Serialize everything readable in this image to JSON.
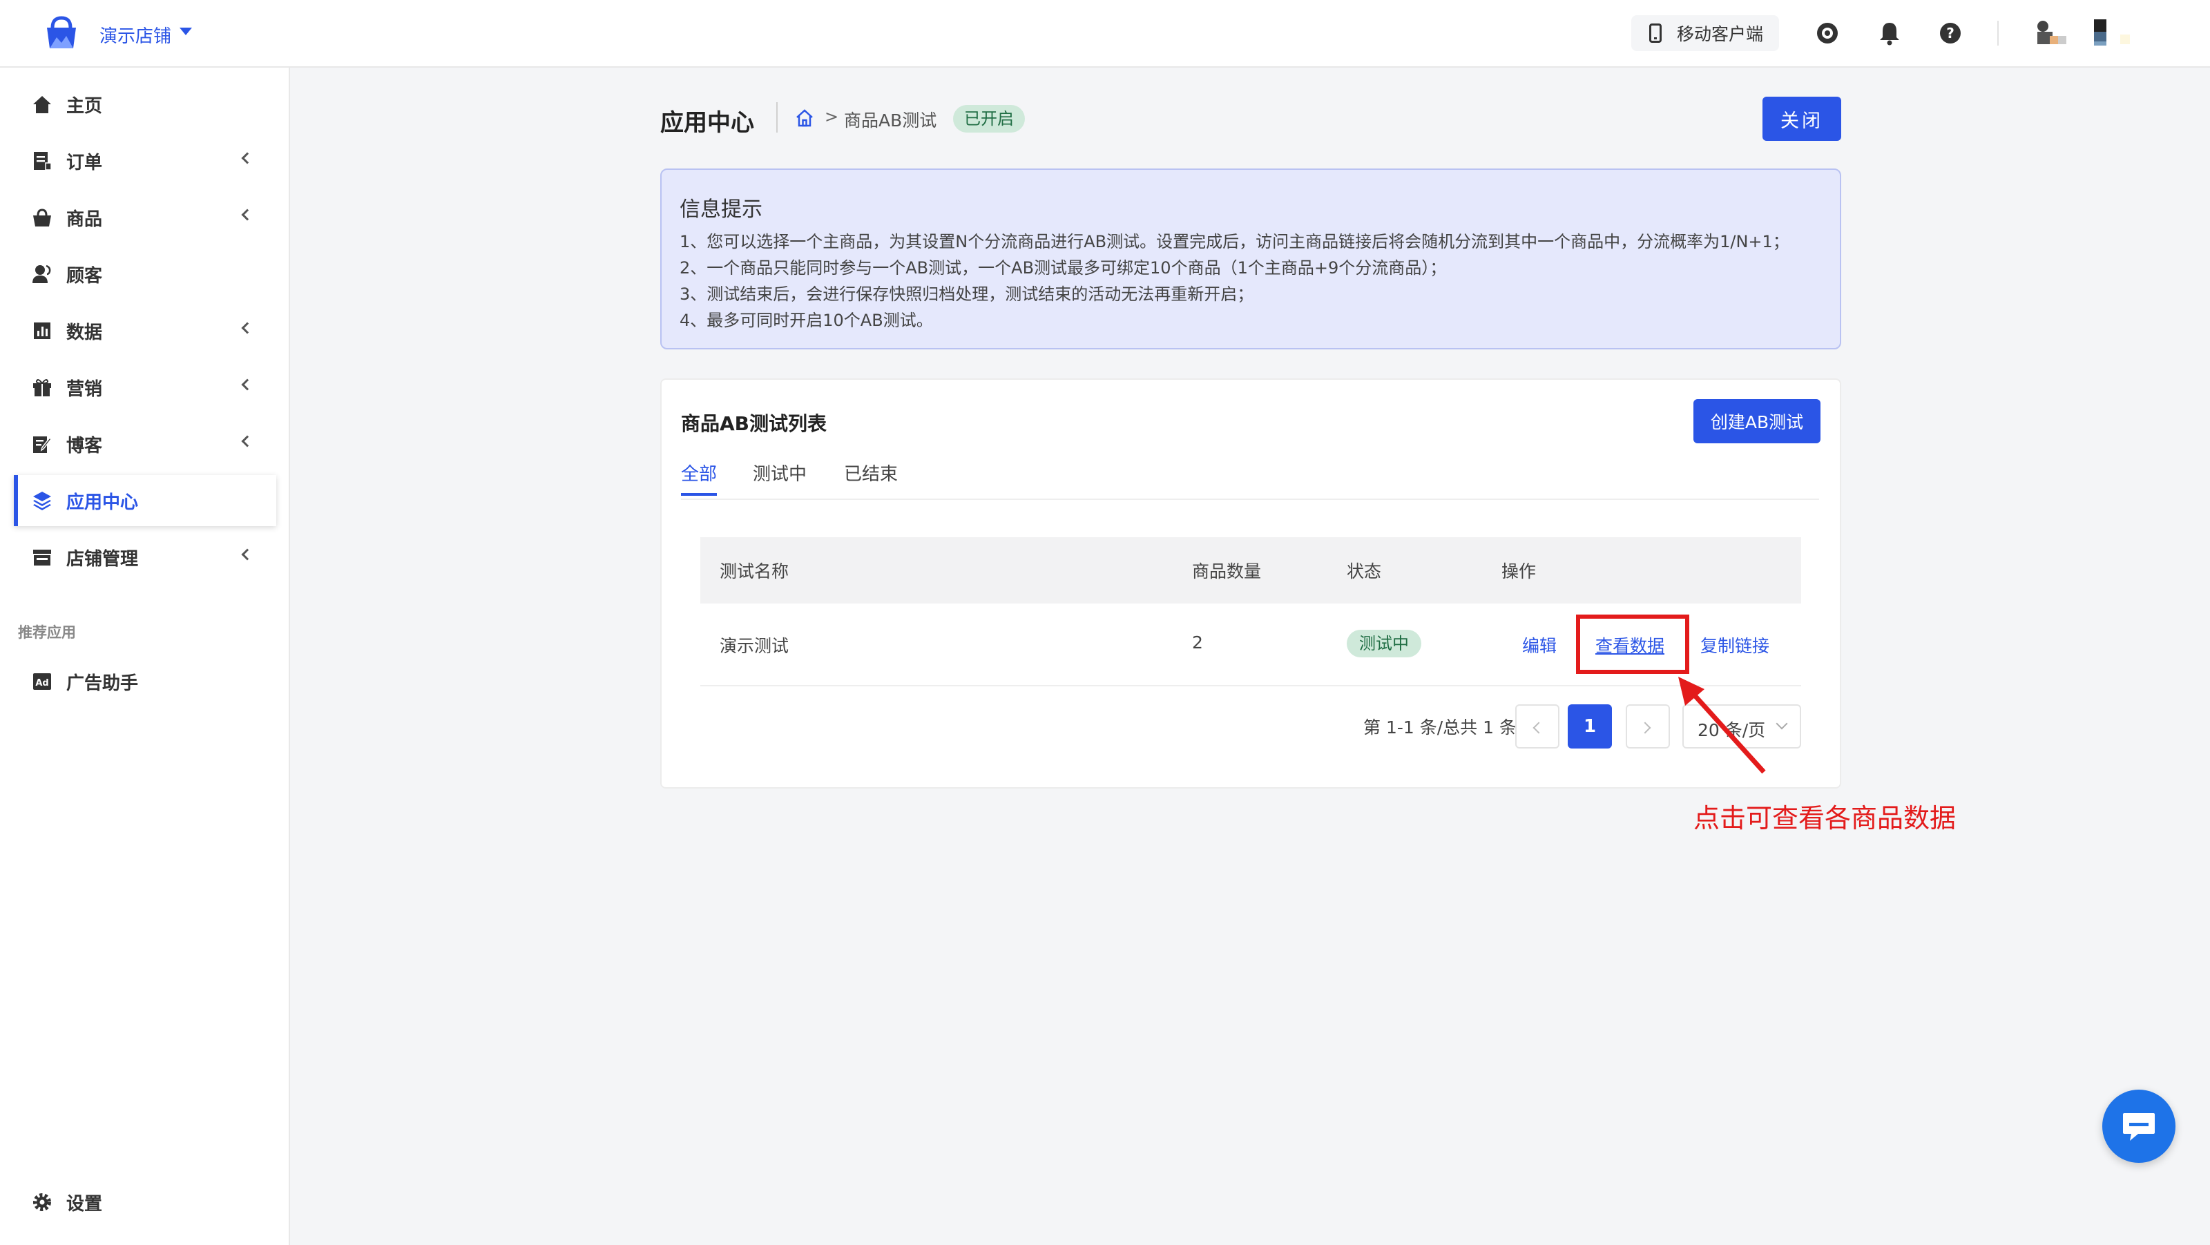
{
  "header": {
    "store_name": "演示店铺",
    "mobile_client_label": "移动客户端",
    "icons": [
      "eye-icon",
      "bell-icon",
      "help-icon"
    ]
  },
  "sidebar": {
    "items": [
      {
        "label": "主页",
        "icon": "home-icon",
        "has_submenu": false
      },
      {
        "label": "订单",
        "icon": "order-icon",
        "has_submenu": true
      },
      {
        "label": "商品",
        "icon": "basket-icon",
        "has_submenu": true
      },
      {
        "label": "顾客",
        "icon": "users-icon",
        "has_submenu": false
      },
      {
        "label": "数据",
        "icon": "chart-icon",
        "has_submenu": true
      },
      {
        "label": "营销",
        "icon": "gift-icon",
        "has_submenu": true
      },
      {
        "label": "博客",
        "icon": "edit-icon",
        "has_submenu": true
      },
      {
        "label": "应用中心",
        "icon": "layers-icon",
        "has_submenu": false,
        "active": true
      },
      {
        "label": "店铺管理",
        "icon": "store-icon",
        "has_submenu": true
      }
    ],
    "recommended_title": "推荐应用",
    "recommended_items": [
      {
        "label": "广告助手",
        "icon": "ad-icon"
      }
    ],
    "settings_label": "设置"
  },
  "page": {
    "title": "应用中心",
    "breadcrumb_separator": ">",
    "breadcrumb_current": "商品AB测试",
    "status_badge": "已开启",
    "close_button": "关闭"
  },
  "info": {
    "title": "信息提示",
    "lines": [
      "1、您可以选择一个主商品，为其设置N个分流商品进行AB测试。设置完成后，访问主商品链接后将会随机分流到其中一个商品中，分流概率为1/N+1；",
      "2、一个商品只能同时参与一个AB测试，一个AB测试最多可绑定10个商品（1个主商品+9个分流商品）；",
      "3、测试结束后，会进行保存快照归档处理，测试结束的活动无法再重新开启；",
      "4、最多可同时开启10个AB测试。"
    ]
  },
  "list": {
    "title": "商品AB测试列表",
    "create_button": "创建AB测试",
    "tabs": [
      "全部",
      "测试中",
      "已结束"
    ],
    "active_tab": 0,
    "columns": [
      "测试名称",
      "商品数量",
      "状态",
      "操作"
    ],
    "rows": [
      {
        "name": "演示测试",
        "count": "2",
        "status": "测试中",
        "actions": [
          "编辑",
          "查看数据",
          "复制链接"
        ]
      }
    ],
    "pagination": {
      "total_text": "第 1-1 条/总共 1 条",
      "current_page": "1",
      "page_size": "20 条/页"
    }
  },
  "annotation": {
    "text": "点击可查看各商品数据",
    "color": "#e31b1b"
  },
  "colors": {
    "primary": "#2b55e6",
    "info_bg": "#e5e8fc",
    "status_bg": "#cfe9da",
    "status_text": "#1f6d43"
  }
}
